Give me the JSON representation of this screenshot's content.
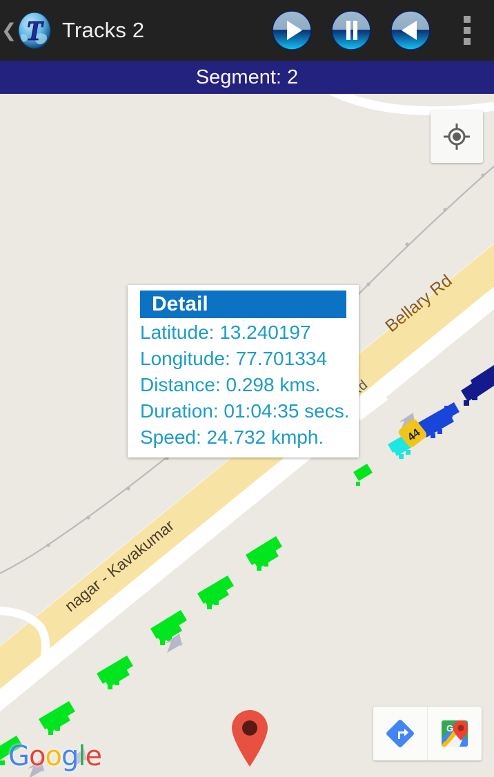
{
  "actionbar": {
    "back_icon": "back-chevron-icon",
    "logo_icon": "globe-t-app-icon",
    "title": "Tracks 2",
    "buttons": [
      {
        "name": "play-button",
        "icon": "play-icon"
      },
      {
        "name": "pause-button",
        "icon": "pause-icon"
      },
      {
        "name": "rewind-button",
        "icon": "rewind-icon"
      }
    ],
    "overflow_icon": "overflow-menu-icon"
  },
  "segment": {
    "label": "Segment: 2"
  },
  "map": {
    "location_button_icon": "my-location-icon",
    "directions_button_icon": "directions-arrow-icon",
    "google_maps_button_icon": "google-maps-logo-icon",
    "watermark": {
      "letters": [
        {
          "ch": "G",
          "color": "#4285f4"
        },
        {
          "ch": "o",
          "color": "#ea4335"
        },
        {
          "ch": "o",
          "color": "#fbbc05"
        },
        {
          "ch": "g",
          "color": "#4285f4"
        },
        {
          "ch": "l",
          "color": "#34a853"
        },
        {
          "ch": "e",
          "color": "#ea4335"
        }
      ]
    },
    "labels": {
      "highway_name": "Bellary Rd",
      "highway_shield": "44",
      "local_road": "nagar - Kavakumar",
      "minor_road": "Rd"
    },
    "marker_icon": "map-pin-marker",
    "colors": {
      "background": "#ece9e3",
      "highway_fill": "#f7e4a5",
      "road_white": "#ffffff",
      "track_green": "#00e61e",
      "track_blue": "#1945d8",
      "track_navy": "#131b8c",
      "track_cyan": "#1ee6e0",
      "marker_red": "#e8513f"
    }
  },
  "infowindow": {
    "title": "Detail",
    "rows": [
      "Latitude: 13.240197",
      "Longitude: 77.701334",
      "Distance: 0.298 kms.",
      "Duration: 01:04:35 secs.",
      "Speed: 24.732 kmph."
    ]
  }
}
